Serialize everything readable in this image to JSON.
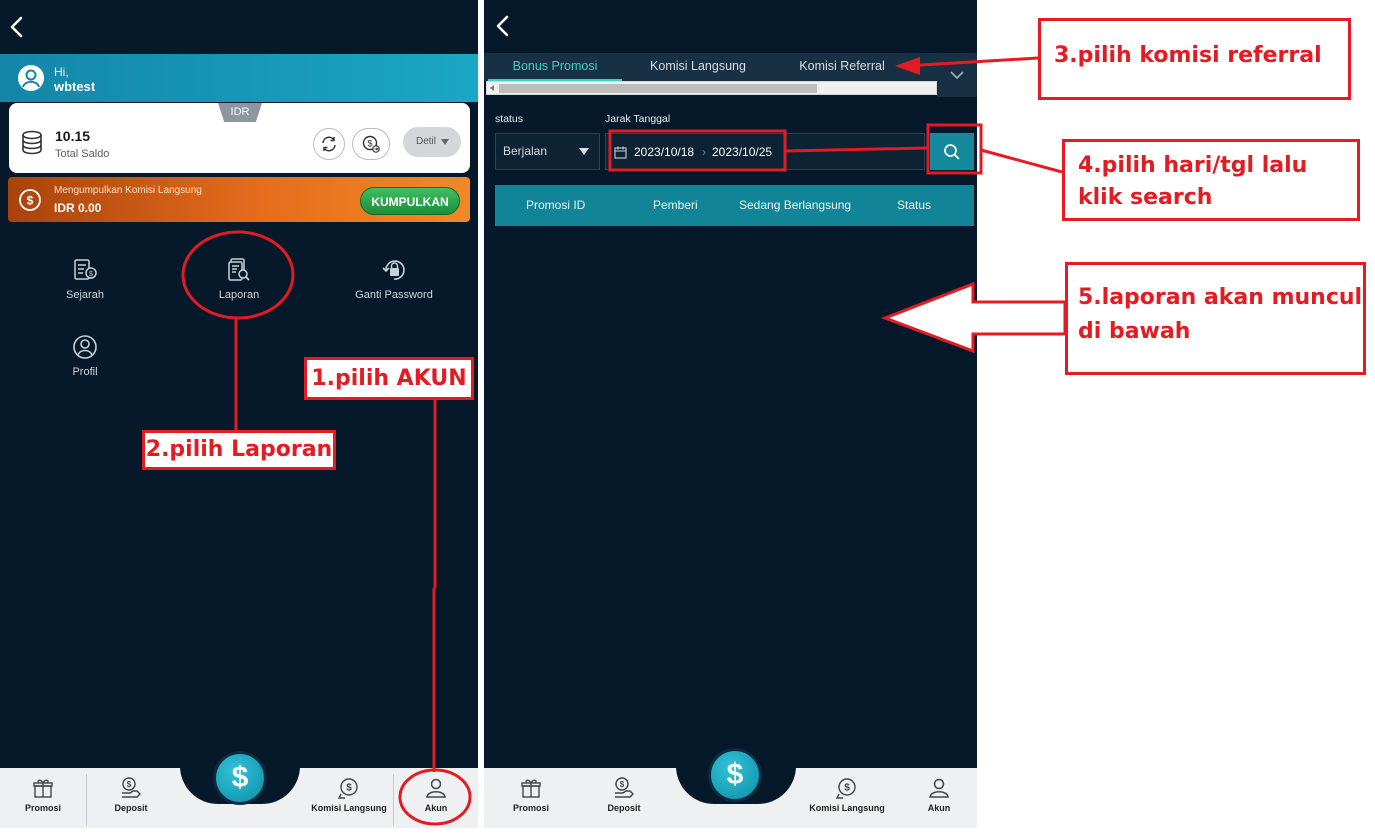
{
  "left_screen": {
    "greeting": {
      "hi": "Hi,",
      "username": "wbtest"
    },
    "balance": {
      "currency": "IDR",
      "amount": "10.15",
      "label": "Total Saldo",
      "detail_button": "Detil"
    },
    "komisi": {
      "label": "Mengumpulkan Komisi Langsung",
      "amount": "IDR 0.00",
      "button": "KUMPULKAN"
    },
    "menu": [
      {
        "label": "Sejarah",
        "icon": "history-icon"
      },
      {
        "label": "Laporan",
        "icon": "report-icon"
      },
      {
        "label": "Ganti Password",
        "icon": "lock-icon"
      },
      {
        "label": "Profil",
        "icon": "profile-icon"
      }
    ],
    "bottom_nav": [
      {
        "label": "Promosi",
        "icon": "gift-icon"
      },
      {
        "label": "Deposit",
        "icon": "deposit-icon"
      },
      {
        "label": "$",
        "icon": "dollar-icon"
      },
      {
        "label": "Komisi Langsung",
        "icon": "commission-icon"
      },
      {
        "label": "Akun",
        "icon": "user-icon"
      }
    ]
  },
  "right_screen": {
    "tabs": [
      {
        "label": "Bonus Promosi",
        "active": true
      },
      {
        "label": "Komisi Langsung",
        "active": false
      },
      {
        "label": "Komisi Referral",
        "active": false
      }
    ],
    "filters": {
      "status_label": "status",
      "status_value": "Berjalan",
      "date_label": "Jarak Tanggal",
      "date_from": "2023/10/18",
      "date_to": "2023/10/25"
    },
    "table_columns": [
      "Promosi ID",
      "Pemberi",
      "Sedang Berlangsung",
      "Status"
    ],
    "bottom_nav": [
      {
        "label": "Promosi",
        "icon": "gift-icon"
      },
      {
        "label": "Deposit",
        "icon": "deposit-icon"
      },
      {
        "label": "$",
        "icon": "dollar-icon"
      },
      {
        "label": "Komisi Langsung",
        "icon": "commission-icon"
      },
      {
        "label": "Akun",
        "icon": "user-icon"
      }
    ]
  },
  "annotations": {
    "step1": "1.pilih AKUN",
    "step2": "2.pilih Laporan",
    "step3": "3.pilih komisi referral",
    "step4": "4.pilih hari/tgl lalu klik search",
    "step5": "5.laporan akan muncul di bawah"
  },
  "colors": {
    "app_bg": "#06192a",
    "accent_teal": "#118597",
    "active_tab": "#3ed3c6",
    "annotation_red": "#e31b23",
    "komisi_orange": "#e56d1d",
    "kumpulkan_green": "#2aa84c"
  }
}
